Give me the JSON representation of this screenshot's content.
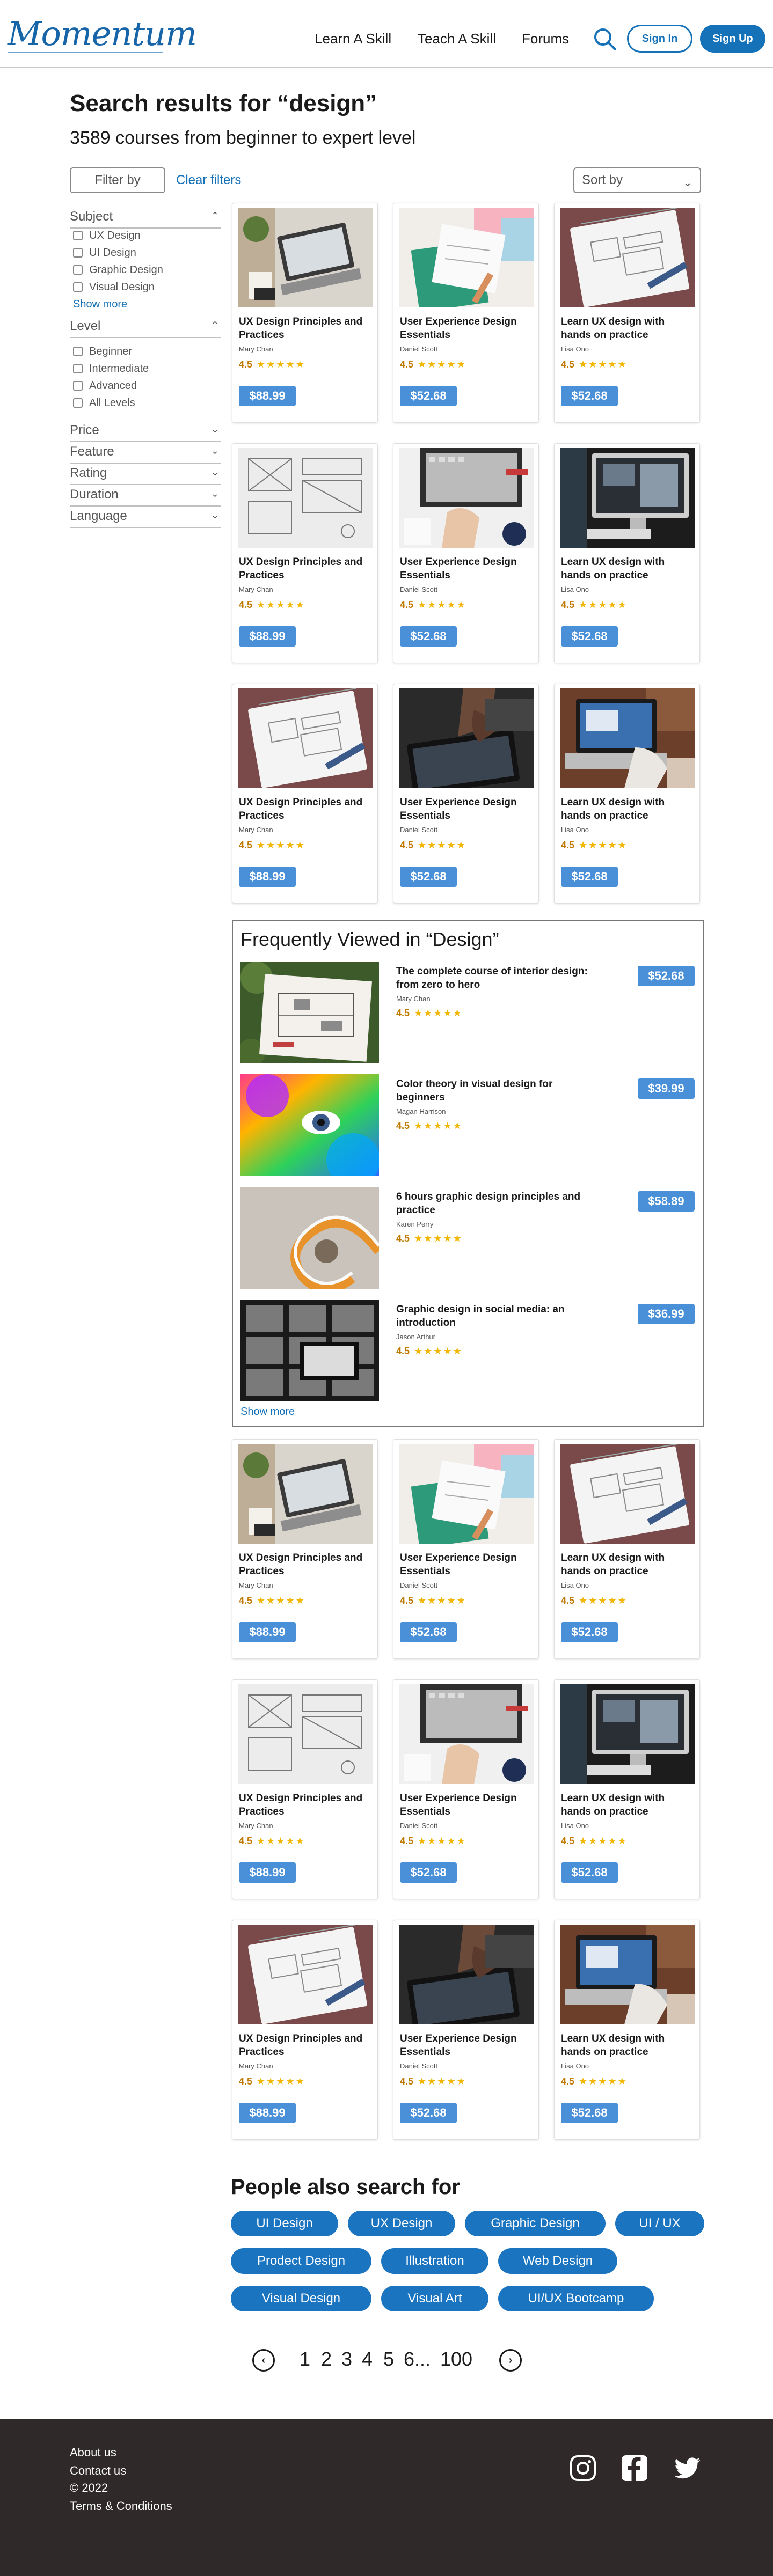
{
  "header": {
    "logo": "Momentum",
    "nav": [
      "Learn A Skill",
      "Teach A Skill",
      "Forums"
    ],
    "signin": "Sign In",
    "signup": "Sign Up"
  },
  "search": {
    "title": "Search results for “design”",
    "count": "3589 courses from beginner to expert level",
    "filter_by": "Filter by",
    "clear_filters": "Clear filters",
    "sort_by": "Sort by"
  },
  "sidebar": {
    "subject": {
      "label": "Subject",
      "options": [
        "UX Design",
        "UI Design",
        "Graphic Design",
        "Visual Design"
      ],
      "show_more": "Show more"
    },
    "level": {
      "label": "Level",
      "options": [
        "Beginner",
        "Intermediate",
        "Advanced",
        "All Levels"
      ]
    },
    "collapsed": [
      "Price",
      "Feature",
      "Rating",
      "Duration",
      "Language"
    ]
  },
  "courses": [
    {
      "title": "UX Design Principles and Practices",
      "author": "Mary Chan",
      "rating": "4.5",
      "price": "$88.99",
      "img": "laptop-desk"
    },
    {
      "title": "User Experience Design Essentials",
      "author": "Daniel Scott",
      "rating": "4.5",
      "price": "$52.68",
      "img": "sketch-pastel"
    },
    {
      "title": "Learn UX design with hands on practice",
      "author": "Lisa Ono",
      "rating": "4.5",
      "price": "$52.68",
      "img": "notebook-wire"
    },
    {
      "title": "UX Design Principles and Practices",
      "author": "Mary Chan",
      "rating": "4.5",
      "price": "$88.99",
      "img": "wireframe"
    },
    {
      "title": "User Experience Design Essentials",
      "author": "Daniel Scott",
      "rating": "4.5",
      "price": "$52.68",
      "img": "laptop-top"
    },
    {
      "title": "Learn UX design with hands on practice",
      "author": "Lisa Ono",
      "rating": "4.5",
      "price": "$52.68",
      "img": "imac-dark"
    },
    {
      "title": "UX Design Principles and Practices",
      "author": "Mary Chan",
      "rating": "4.5",
      "price": "$88.99",
      "img": "notebook-wire"
    },
    {
      "title": "User Experience Design Essentials",
      "author": "Daniel Scott",
      "rating": "4.5",
      "price": "$52.68",
      "img": "tablet-hands"
    },
    {
      "title": "Learn UX design with hands on practice",
      "author": "Lisa Ono",
      "rating": "4.5",
      "price": "$52.68",
      "img": "laptop-work"
    }
  ],
  "frequently_viewed": {
    "title": "Frequently Viewed in “Design”",
    "items": [
      {
        "title": "The complete course of interior design: from zero to hero",
        "author": "Mary Chan",
        "rating": "4.5",
        "price": "$52.68",
        "img": "interior"
      },
      {
        "title": "Color theory in visual design for beginners",
        "author": "Magan Harrison",
        "rating": "4.5",
        "price": "$39.99",
        "img": "color-face"
      },
      {
        "title": "6 hours graphic design principles and practice",
        "author": "Karen Perry",
        "rating": "4.5",
        "price": "$58.89",
        "img": "spiral"
      },
      {
        "title": "Graphic design in social media: an introduction",
        "author": "Jason Arthur",
        "rating": "4.5",
        "price": "$36.99",
        "img": "grid-bw"
      }
    ],
    "show_more": "Show more"
  },
  "stars": "★★★★★",
  "people_also_search": {
    "title": "People also search for",
    "chips": [
      "UI Design",
      "UX Design",
      "Graphic Design",
      "UI / UX",
      "Prodect Design",
      "Illustration",
      "Web Design",
      "Visual Design",
      "Visual Art",
      "UI/UX Bootcamp"
    ]
  },
  "pagination": {
    "prev": "‹",
    "next": "›",
    "pages": [
      "1",
      "2",
      "3",
      "4",
      "5",
      "6...",
      "100"
    ]
  },
  "footer": {
    "links": [
      "About us",
      "Contact us",
      "© 2022",
      "Terms & Conditions"
    ]
  },
  "colors": {
    "accent": "#1571b8",
    "price_badge": "#4a90d9",
    "chip": "#1a74c0",
    "footer_bg": "#2f2a29",
    "star": "#f2b705"
  }
}
